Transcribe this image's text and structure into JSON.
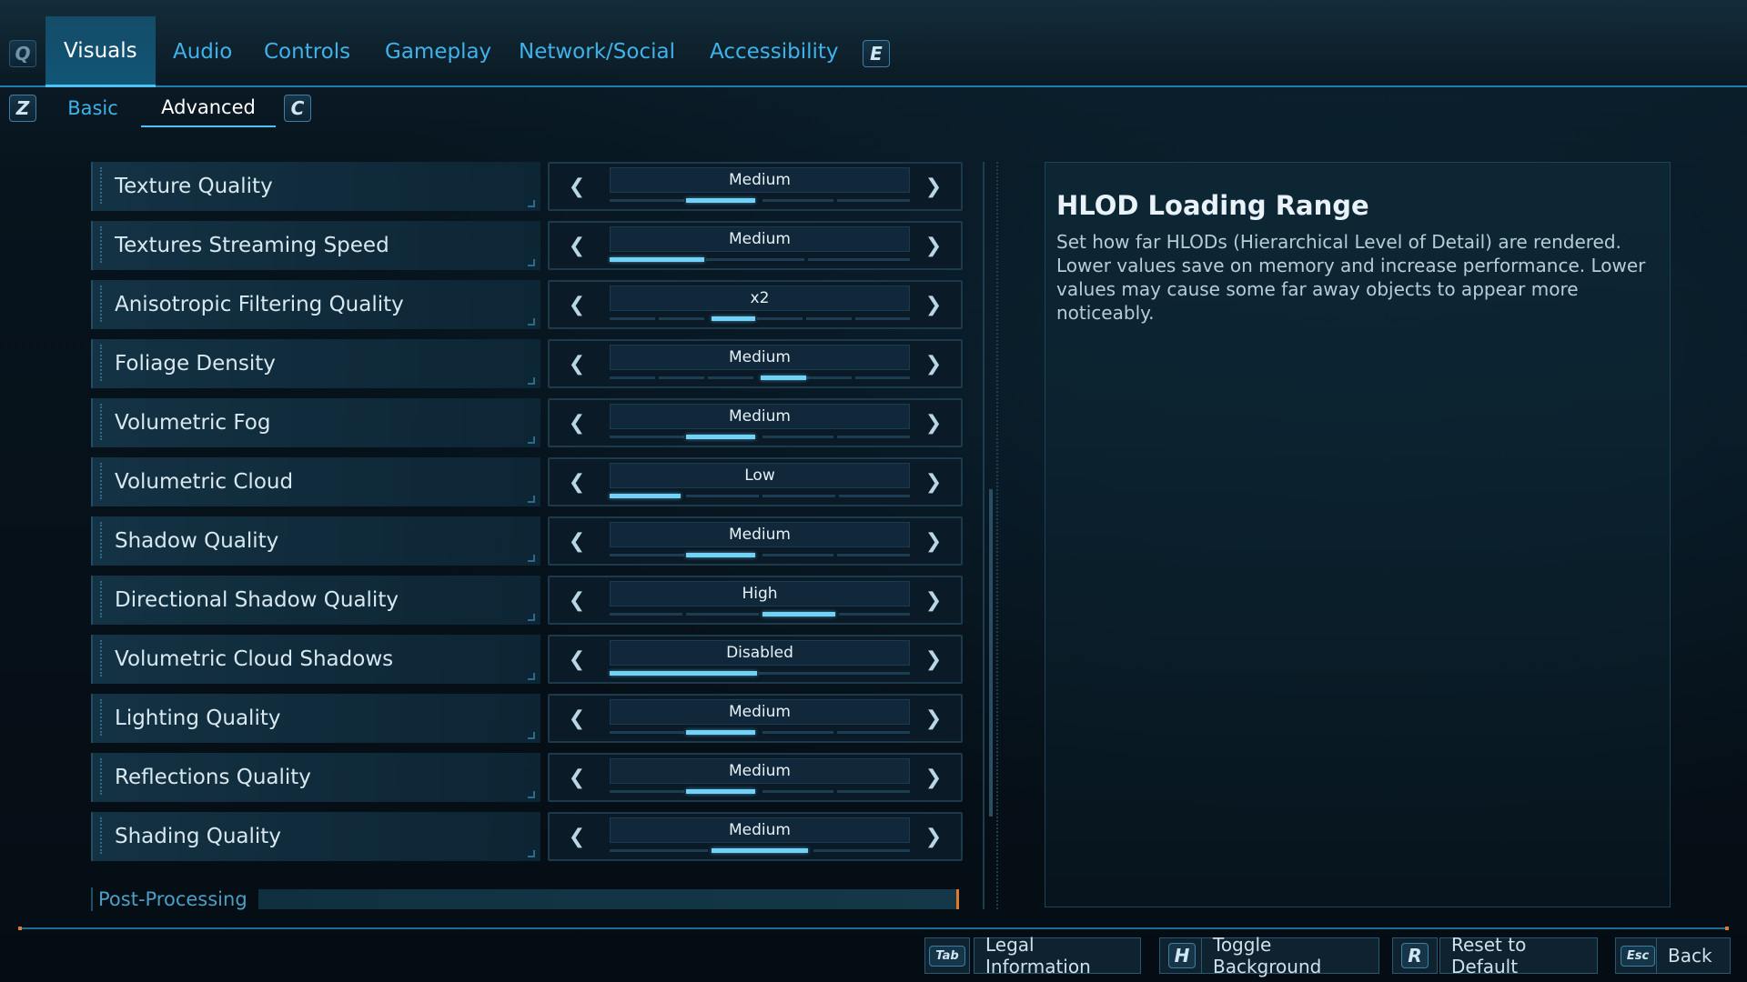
{
  "tabs": {
    "prev_key": "Q",
    "next_key": "E",
    "items": [
      "Visuals",
      "Audio",
      "Controls",
      "Gameplay",
      "Network/Social",
      "Accessibility"
    ],
    "active": "Visuals"
  },
  "subtabs": {
    "prev_key": "Z",
    "next_key": "C",
    "items": [
      "Basic",
      "Advanced"
    ],
    "active": "Advanced"
  },
  "settings": [
    {
      "label": "Texture Quality",
      "value": "Medium"
    },
    {
      "label": "Textures Streaming Speed",
      "value": "Medium"
    },
    {
      "label": "Anisotropic Filtering Quality",
      "value": "x2"
    },
    {
      "label": "Foliage Density",
      "value": "Medium"
    },
    {
      "label": "Volumetric Fog",
      "value": "Medium"
    },
    {
      "label": "Volumetric Cloud",
      "value": "Low"
    },
    {
      "label": "Shadow Quality",
      "value": "Medium"
    },
    {
      "label": "Directional Shadow Quality",
      "value": "High"
    },
    {
      "label": "Volumetric Cloud Shadows",
      "value": "Disabled"
    },
    {
      "label": "Lighting Quality",
      "value": "Medium"
    },
    {
      "label": "Reflections Quality",
      "value": "Medium"
    },
    {
      "label": "Shading Quality",
      "value": "Medium"
    }
  ],
  "section_header": "Post-Processing",
  "description": {
    "title": "HLOD Loading Range",
    "body": "Set how far HLODs (Hierarchical Level of Detail) are rendered. Lower values save on memory and increase performance. Lower values may cause some far away objects to appear more noticeably."
  },
  "footer": [
    {
      "key": "Tab",
      "label": "Legal Information"
    },
    {
      "key": "H",
      "label": "Toggle Background"
    },
    {
      "key": "R",
      "label": "Reset to Default"
    },
    {
      "key": "Esc",
      "label": "Back"
    }
  ],
  "colors": {
    "accent": "#3fb2ea",
    "active_tab_bg": "#12587a",
    "slider_fill": "#6fd2f6",
    "corner_marker": "#e07a2c"
  }
}
